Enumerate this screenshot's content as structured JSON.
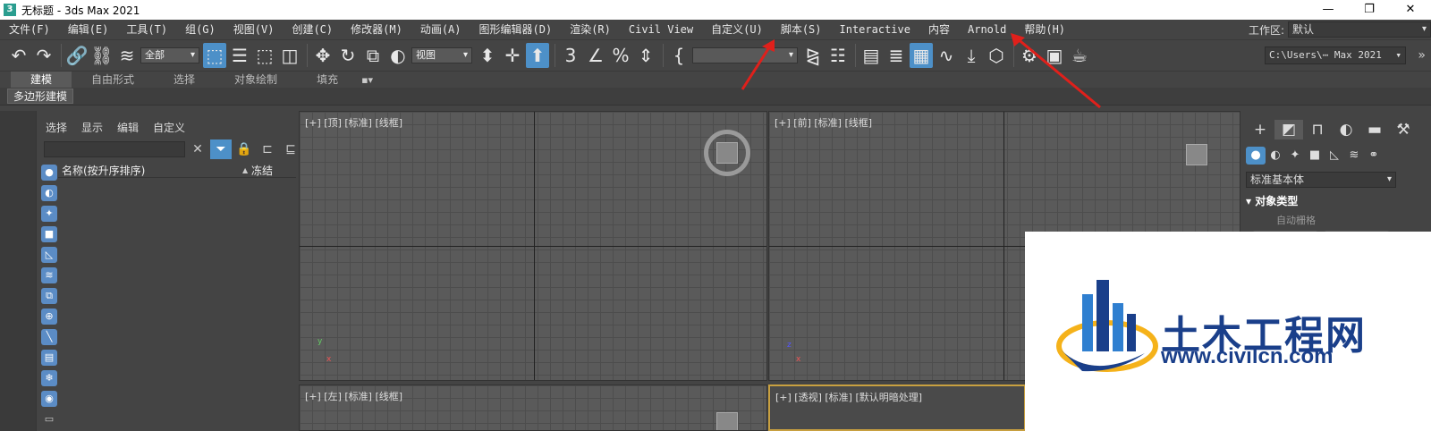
{
  "window": {
    "title": "无标题 - 3ds Max 2021",
    "app_icon": "3",
    "controls": [
      "—",
      "❐",
      "✕"
    ]
  },
  "menu": [
    "文件(F)",
    "编辑(E)",
    "工具(T)",
    "组(G)",
    "视图(V)",
    "创建(C)",
    "修改器(M)",
    "动画(A)",
    "图形编辑器(D)",
    "渲染(R)",
    "Civil View",
    "自定义(U)",
    "脚本(S)",
    "Interactive",
    "内容",
    "Arnold",
    "帮助(H)"
  ],
  "workspace": {
    "label": "工作区:",
    "value": "默认"
  },
  "toolbar": {
    "selection_filter": "全部",
    "ref_coord": "视图",
    "project_path": "C:\\Users\\⋯ Max 2021",
    "more": "»"
  },
  "ribbon": {
    "tabs": [
      "建模",
      "自由形式",
      "选择",
      "对象绘制",
      "填充"
    ],
    "extra": "▪▾",
    "sub_label": "多边形建模"
  },
  "explorer": {
    "menu": [
      "选择",
      "显示",
      "编辑",
      "自定义"
    ],
    "col_name": "名称(按升序排序)",
    "sort_arrow": "▲",
    "col_freeze": "冻结"
  },
  "viewports": {
    "top": "[+] [顶] [标准] [线框]",
    "front": "[+] [前] [标准] [线框]",
    "left": "[+] [左] [标准] [线框]",
    "persp": "[+] [透视] [标准] [默认明暗处理]"
  },
  "command_panel": {
    "dropdown": "标准基本体",
    "rollout": "▾ 对象类型",
    "auto_grid": "自动栅格"
  },
  "watermark": {
    "name": "土木工程网",
    "url": "www.civilcn.com"
  },
  "colors": {
    "accent": "#4d90c8",
    "arrow": "#e0201b",
    "watermark_blue": "#1a3f8a",
    "watermark_gold": "#f5b21a"
  }
}
